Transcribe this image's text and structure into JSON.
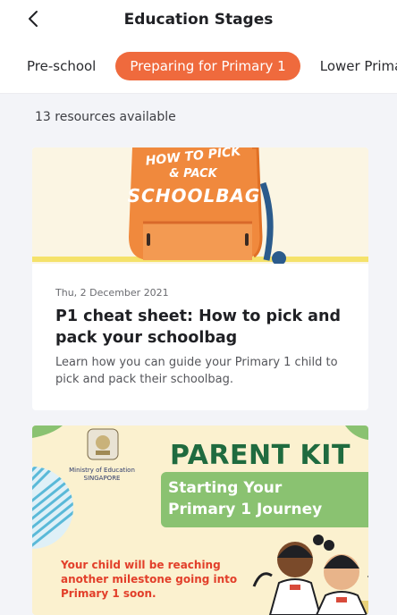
{
  "header": {
    "title": "Education Stages",
    "back_icon": "chevron-left-icon"
  },
  "tabs": [
    {
      "label": "Pre-school",
      "active": false
    },
    {
      "label": "Preparing for Primary 1",
      "active": true
    },
    {
      "label": "Lower Primary",
      "active": false
    }
  ],
  "colors": {
    "accent": "#ef6a3d",
    "banner_green": "#8ac271",
    "kit_green": "#1f6b3f",
    "milestone_red": "#e23f2a"
  },
  "resources": {
    "count_text": "13 resources available",
    "items": [
      {
        "image_text_1": "HOW TO PICK",
        "image_text_2": "& PACK",
        "image_text_3": "SCHOOLBAG",
        "date": "Thu, 2 December 2021",
        "title": "P1 cheat sheet: How to pick and pack your schoolbag",
        "description": "Learn how you can guide your Primary 1 child to pick and pack their schoolbag."
      },
      {
        "moe_line_1": "Ministry of Education",
        "moe_line_2": "SINGAPORE",
        "heading": "PARENT KIT",
        "banner_line_1": "Starting Your",
        "banner_line_2": "Primary 1 Journey",
        "milestone_text": "Your child will be reaching another milestone going into Primary 1 soon."
      }
    ]
  }
}
